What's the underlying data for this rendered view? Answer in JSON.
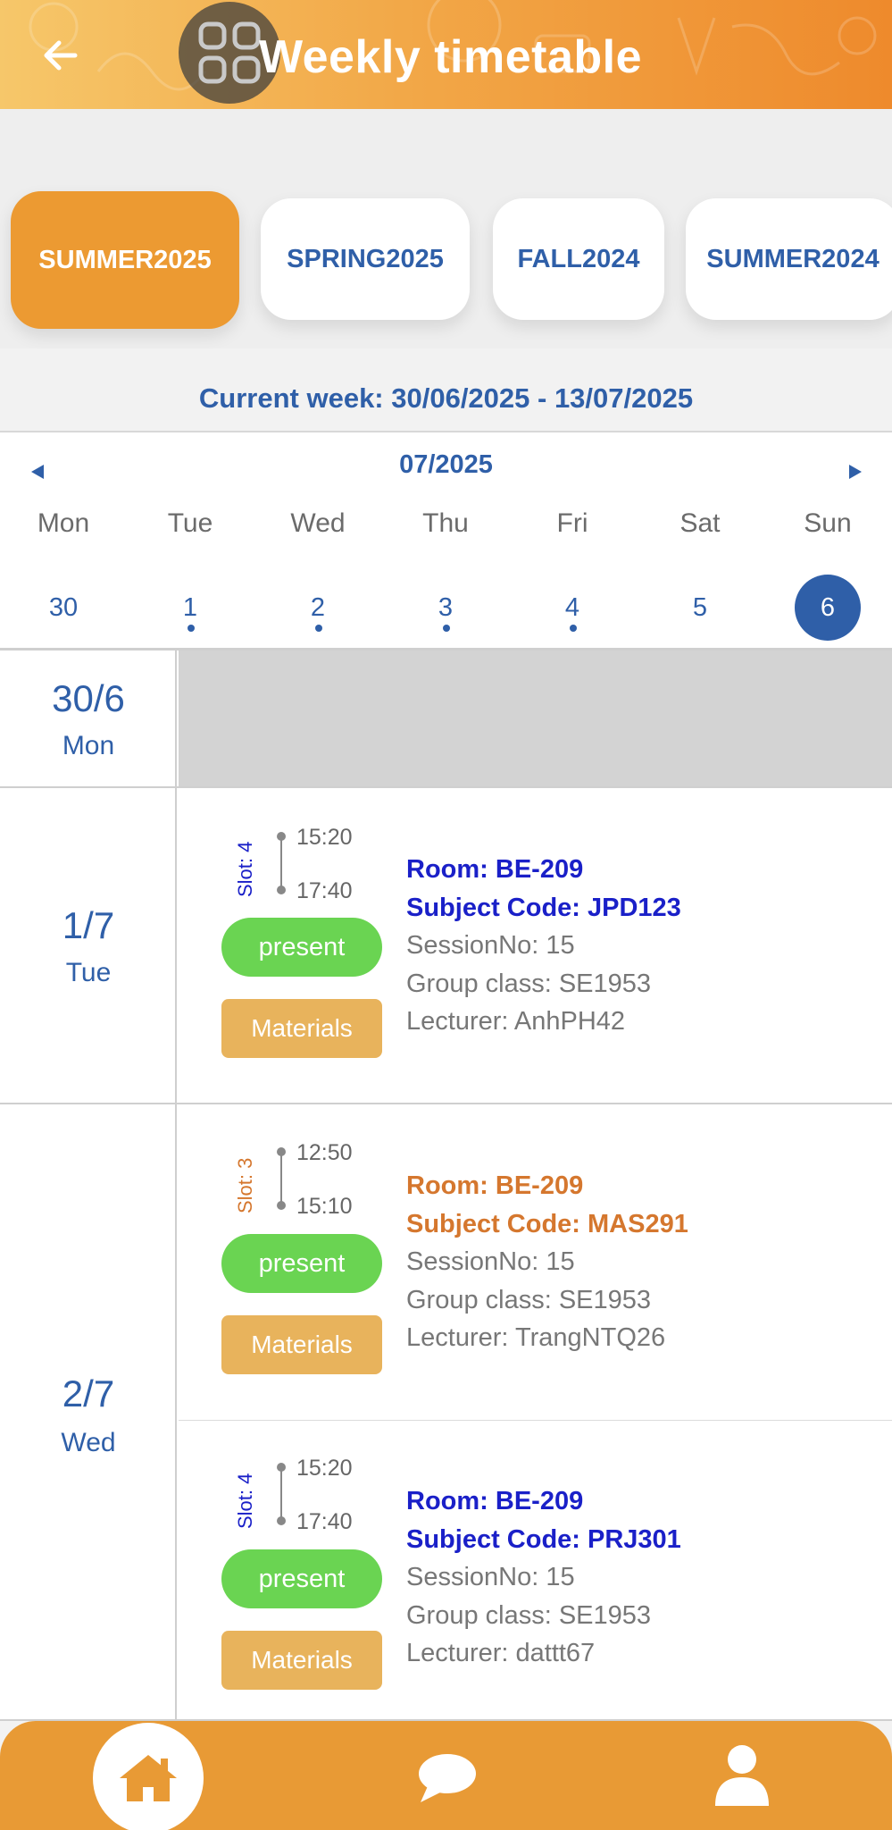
{
  "header": {
    "title": "Weekly timetable"
  },
  "semesters": [
    {
      "label": "SUMMER2025",
      "active": true
    },
    {
      "label": "SPRING2025",
      "active": false
    },
    {
      "label": "FALL2024",
      "active": false
    },
    {
      "label": "SUMMER2024",
      "active": false
    }
  ],
  "current_week": "Current week: 30/06/2025 - 13/07/2025",
  "calendar": {
    "month": "07/2025",
    "days": [
      {
        "dow": "Mon",
        "date": "30",
        "dot": false,
        "selected": false
      },
      {
        "dow": "Tue",
        "date": "1",
        "dot": true,
        "selected": false
      },
      {
        "dow": "Wed",
        "date": "2",
        "dot": true,
        "selected": false
      },
      {
        "dow": "Thu",
        "date": "3",
        "dot": true,
        "selected": false
      },
      {
        "dow": "Fri",
        "date": "4",
        "dot": true,
        "selected": false
      },
      {
        "dow": "Sat",
        "date": "5",
        "dot": false,
        "selected": false
      },
      {
        "dow": "Sun",
        "date": "6",
        "dot": false,
        "selected": true
      }
    ]
  },
  "timetable": [
    {
      "date": "30/6",
      "weekday": "Mon",
      "sessions": []
    },
    {
      "date": "1/7",
      "weekday": "Tue",
      "sessions": [
        {
          "slot": "Slot: 4",
          "start": "15:20",
          "end": "17:40",
          "attendance": "present",
          "materials": "Materials",
          "room": "Room: BE-209",
          "subject": "Subject Code: JPD123",
          "session_no": "SessionNo: 15",
          "group": "Group class: SE1953",
          "lecturer": "Lecturer: AnhPH42",
          "accent": "#1a20c8"
        }
      ]
    },
    {
      "date": "2/7",
      "weekday": "Wed",
      "sessions": [
        {
          "slot": "Slot: 3",
          "start": "12:50",
          "end": "15:10",
          "attendance": "present",
          "materials": "Materials",
          "room": "Room: BE-209",
          "subject": "Subject Code: MAS291",
          "session_no": "SessionNo: 15",
          "group": "Group class: SE1953",
          "lecturer": "Lecturer: TrangNTQ26",
          "accent": "#d5772e"
        },
        {
          "slot": "Slot: 4",
          "start": "15:20",
          "end": "17:40",
          "attendance": "present",
          "materials": "Materials",
          "room": "Room: BE-209",
          "subject": "Subject Code: PRJ301",
          "session_no": "SessionNo: 15",
          "group": "Group class: SE1953",
          "lecturer": "Lecturer: dattt67",
          "accent": "#1a20c8"
        }
      ]
    }
  ],
  "colors": {
    "brand_orange": "#ec9a32",
    "brand_blue": "#2f5fa8",
    "present_green": "#6ad452",
    "materials": "#e8b35c"
  }
}
